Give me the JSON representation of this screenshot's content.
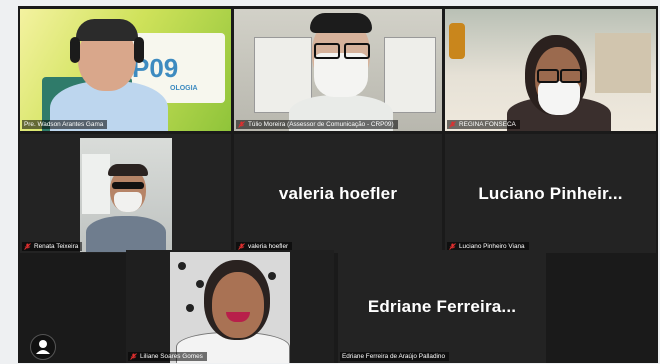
{
  "participants": [
    {
      "name": "Pre. Wadson Arantes Gama",
      "video": true
    },
    {
      "name": "Túlio Moreira (Assessor de Comunicação - CRP09)",
      "video": true
    },
    {
      "name": "REGINA FONSECA",
      "video": true
    },
    {
      "name": "Renata Teixeira",
      "video": true
    },
    {
      "name": "valeria hoefler",
      "video": false,
      "display_name": "valeria hoefler"
    },
    {
      "name": "Luciano Pinheiro Viana",
      "video": false,
      "display_name": "Luciano  Pinheir..."
    },
    {
      "name": "Liliane Soares Gomes",
      "video": true
    },
    {
      "name": "Edriane Ferreira de Araújo Palladino",
      "video": false,
      "display_name": "Edriane  Ferreira..."
    }
  ],
  "backdrop_text": {
    "logo_number": "P09",
    "logo_sub": "OLOGIA"
  },
  "colors": {
    "tile_background": "#232323",
    "grid_gap": "#1a1a1a",
    "muted_mic": "#e02f2f",
    "page_background": "#eef0f2"
  },
  "icons": {
    "muted": "mic-muted-icon",
    "profile": "user-profile-icon"
  }
}
